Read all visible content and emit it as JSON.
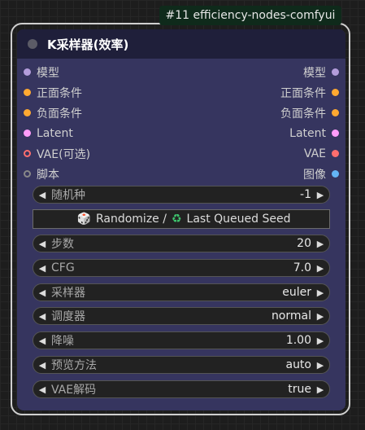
{
  "badge": "#11 efficiency-nodes-comfyui",
  "node": {
    "title": "K采样器(效率)",
    "inputs": [
      {
        "label": "模型",
        "color": "#b39ddb"
      },
      {
        "label": "正面条件",
        "color": "#ffa931"
      },
      {
        "label": "负面条件",
        "color": "#ffa931"
      },
      {
        "label": "Latent",
        "color": "#ff9cf9"
      },
      {
        "label": "VAE(可选)",
        "color": "#ff6e6e"
      },
      {
        "label": "脚本",
        "color": "#888888"
      }
    ],
    "outputs": [
      {
        "label": "模型",
        "color": "#b39ddb"
      },
      {
        "label": "正面条件",
        "color": "#ffa931"
      },
      {
        "label": "负面条件",
        "color": "#ffa931"
      },
      {
        "label": "Latent",
        "color": "#ff9cf9"
      },
      {
        "label": "VAE",
        "color": "#ff6e6e"
      },
      {
        "label": "图像",
        "color": "#64b5f6"
      }
    ],
    "widgets": [
      {
        "label": "随机种",
        "value": "-1"
      },
      {
        "label": "步数",
        "value": "20"
      },
      {
        "label": "CFG",
        "value": "7.0"
      },
      {
        "label": "采样器",
        "value": "euler"
      },
      {
        "label": "调度器",
        "value": "normal"
      },
      {
        "label": "降噪",
        "value": "1.00"
      },
      {
        "label": "预览方法",
        "value": "auto"
      },
      {
        "label": "VAE解码",
        "value": "true"
      }
    ],
    "seed_button": {
      "icon_left": "🎲",
      "text_left": "Randomize /",
      "icon_right": "♻",
      "text_right": "Last Queued Seed"
    }
  }
}
